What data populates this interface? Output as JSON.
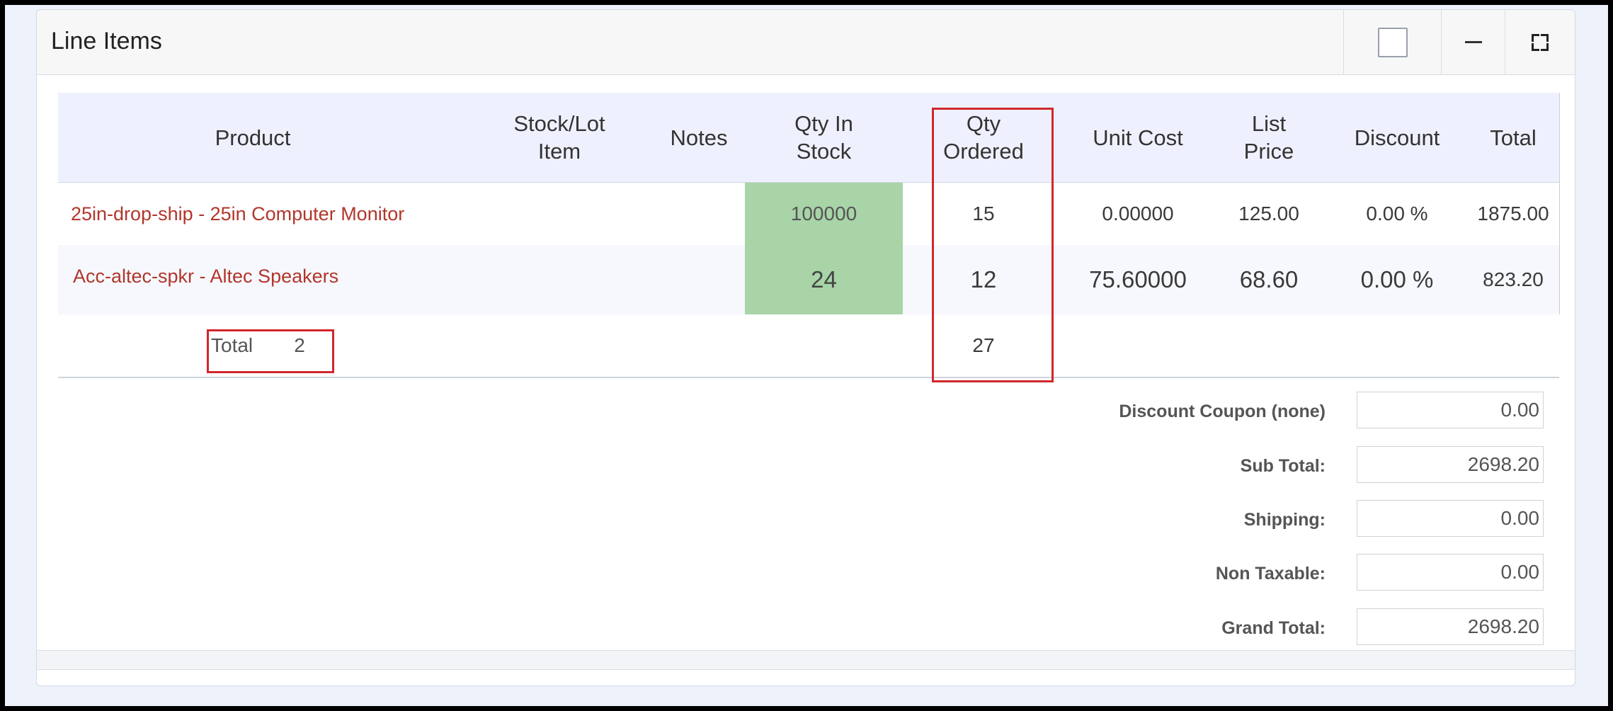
{
  "panel": {
    "title": "Line Items",
    "header_icons": [
      "checkbox-icon",
      "minimize-icon",
      "expand-icon"
    ]
  },
  "table": {
    "headers": {
      "product": "Product",
      "stock_lot": "Stock/Lot\nItem",
      "notes": "Notes",
      "qty_in_stock": "Qty In\nStock",
      "qty_ordered": "Qty\nOrdered",
      "unit_cost": "Unit Cost",
      "list_price": "List\nPrice",
      "discount": "Discount",
      "total": "Total"
    },
    "rows": [
      {
        "product": "25in-drop-ship - 25in Computer Monitor",
        "stock_lot": "",
        "notes": "",
        "qty_in_stock": "100000",
        "qty_ordered": "15",
        "unit_cost": "0.00000",
        "list_price": "125.00",
        "discount": "0.00 %",
        "total": "1875.00"
      },
      {
        "product": "Acc-altec-spkr - Altec Speakers",
        "stock_lot": "",
        "notes": "",
        "qty_in_stock": "24",
        "qty_ordered": "12",
        "unit_cost": "75.60000",
        "list_price": "68.60",
        "discount": "0.00 %",
        "total": "823.20"
      }
    ],
    "totals": {
      "label": "Total",
      "count": "2",
      "qty_ordered": "27"
    }
  },
  "summary": {
    "discount_coupon": {
      "label": "Discount Coupon (none)",
      "value": "0.00"
    },
    "sub_total": {
      "label": "Sub Total:",
      "value": "2698.20"
    },
    "shipping": {
      "label": "Shipping:",
      "value": "0.00"
    },
    "non_taxable": {
      "label": "Non Taxable:",
      "value": "0.00"
    },
    "grand_total": {
      "label": "Grand Total:",
      "value": "2698.20"
    }
  },
  "colors": {
    "product_link": "#b1362b",
    "stock_highlight": "#a8d4a8",
    "highlight_box": "#d0272d",
    "header_bg": "#eef1fd"
  }
}
